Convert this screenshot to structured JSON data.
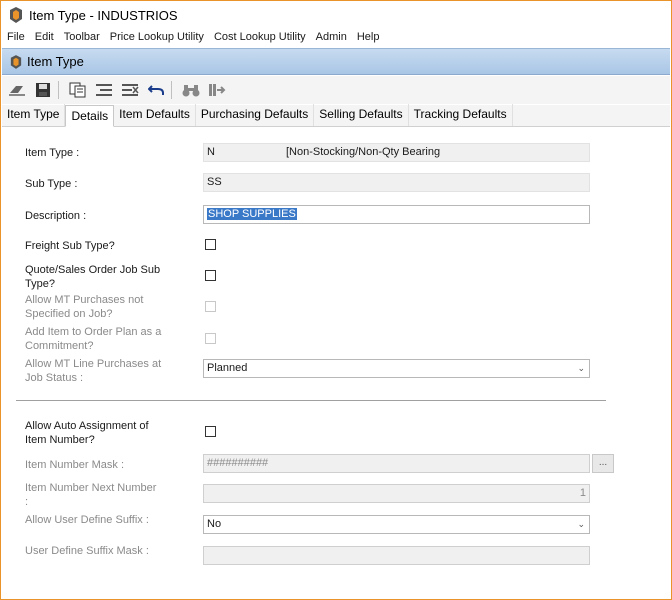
{
  "window": {
    "title": "Item Type - INDUSTRIOS"
  },
  "menu": [
    "File",
    "Edit",
    "Toolbar",
    "Price Lookup Utility",
    "Cost Lookup Utility",
    "Admin",
    "Help"
  ],
  "inner_window": {
    "title": "Item Type"
  },
  "toolbar": {
    "icons": [
      "eraser-icon",
      "save-icon",
      "copy-icon",
      "list-icon",
      "list-delete-icon",
      "undo-icon",
      "binoculars-icon",
      "export-icon"
    ]
  },
  "tabs": [
    {
      "label": "Item Type",
      "active": false
    },
    {
      "label": "Details",
      "active": true
    },
    {
      "label": "Item Defaults",
      "active": false
    },
    {
      "label": "Purchasing Defaults",
      "active": false
    },
    {
      "label": "Selling Defaults",
      "active": false
    },
    {
      "label": "Tracking Defaults",
      "active": false
    }
  ],
  "form": {
    "item_type": {
      "label": "Item Type :",
      "code": "N",
      "description": "[Non-Stocking/Non-Qty Bearing"
    },
    "sub_type": {
      "label": "Sub Type :",
      "value": "SS"
    },
    "description": {
      "label": "Description :",
      "value": "SHOP SUPPLIES"
    },
    "freight_sub_type": {
      "label": "Freight Sub Type?",
      "checked": false
    },
    "quote_sales_order": {
      "label_line1": "Quote/Sales Order Job Sub",
      "label_line2": "Type?",
      "checked": false
    },
    "allow_mt_purchases": {
      "label_line1": "Allow MT Purchases not",
      "label_line2": "Specified on Job?",
      "checked": false
    },
    "add_item_order_plan": {
      "label_line1": "Add Item to Order Plan as a",
      "label_line2": "Commitment?",
      "checked": false
    },
    "allow_mt_line_purchases": {
      "label_line1": "Allow MT Line Purchases at",
      "label_line2": "Job Status :",
      "value": "Planned"
    },
    "allow_auto_assignment": {
      "label_line1": "Allow Auto Assignment of",
      "label_line2": "Item Number?",
      "checked": false
    },
    "item_number_mask": {
      "label": "Item Number Mask :",
      "value": "##########",
      "button": "..."
    },
    "item_number_next": {
      "label_line1": "Item Number Next Number",
      "label_line2": ":",
      "value": "1"
    },
    "allow_user_define_suffix": {
      "label": "Allow User Define Suffix :",
      "value": "No"
    },
    "user_define_suffix_mask": {
      "label": "User Define Suffix Mask :",
      "value": ""
    }
  }
}
